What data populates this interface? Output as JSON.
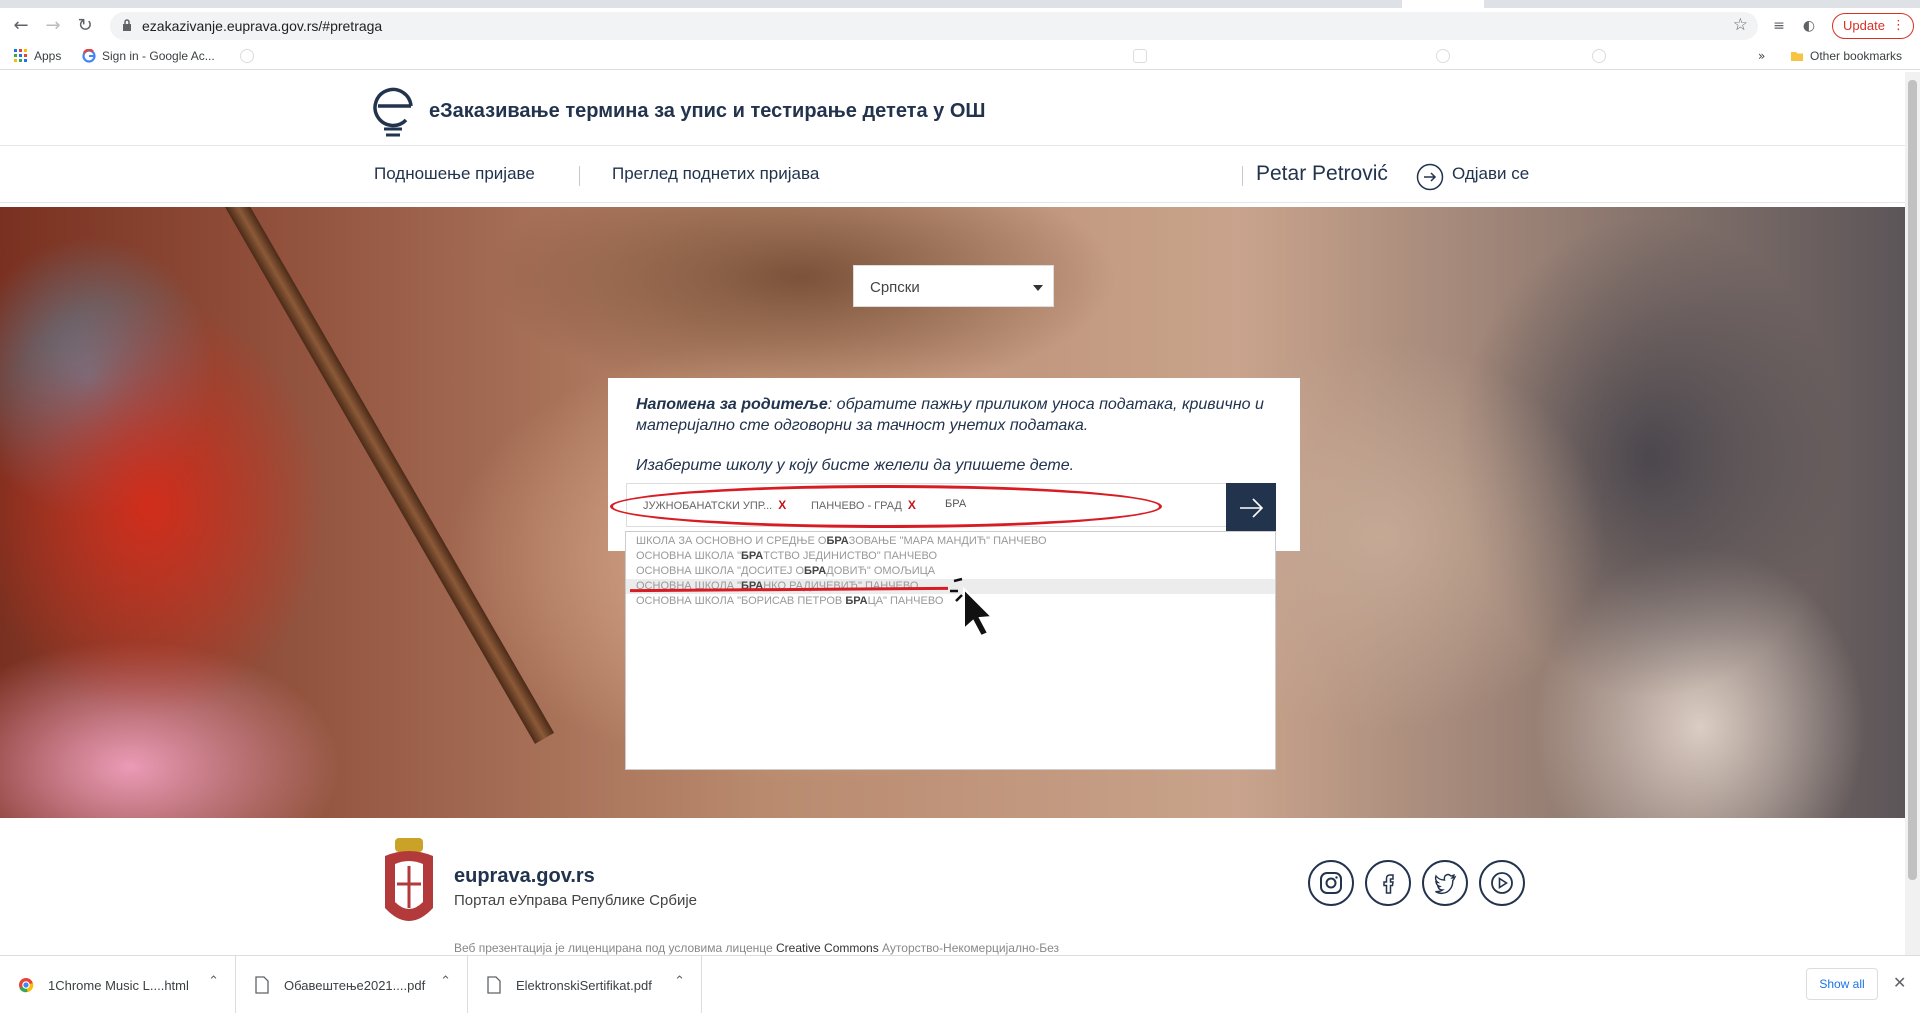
{
  "browser": {
    "url": "ezakazivanje.euprava.gov.rs/#pretraga",
    "update_label": "Update",
    "bookmarks": [
      {
        "label": "Apps",
        "icon": "apps-grid-icon"
      },
      {
        "label": "Sign in - Google Ac...",
        "icon": "google-icon"
      }
    ],
    "more_bookmarks": "»",
    "other_bookmarks": "Other bookmarks"
  },
  "site": {
    "title": "еЗаказивање термина за упис и тестирање детета у ОШ",
    "nav": [
      "Подношење пријаве",
      "Преглед поднетих пријава"
    ],
    "user": "Petar Petrović",
    "logout": "Одјави се"
  },
  "hero": {
    "language": "Српски",
    "notice_bold": "Напомена за родитеље",
    "notice_text": ": обратите пажњу приликом уноса података, кривично и материјално сте одговорни за тачност унетих података.",
    "choose_school": "Изаберите школу у коју бисте желели да упишете дете.",
    "filters": [
      {
        "label": "ЈУЖНОБАНАТСКИ УПР..."
      },
      {
        "label": "ПАНЧЕВО - ГРАД"
      }
    ],
    "remove_symbol": "X",
    "query": "БРА",
    "suggestions": [
      {
        "pre": "ШКОЛА ЗА ОСНОВНО И СРЕДЊЕ О",
        "match": "БРА",
        "post": "ЗОВАЊЕ \"МАРА МАНДИЋ\" ПАНЧЕВО",
        "highlighted": false
      },
      {
        "pre": "ОСНОВНА ШКОЛА \"",
        "match": "БРА",
        "post": "ТСТВО ЈЕДИНИСТВО\" ПАНЧЕВО",
        "highlighted": false
      },
      {
        "pre": "ОСНОВНА ШКОЛА \"ДОСИТЕЈ О",
        "match": "БРА",
        "post": "ДОВИЋ\" ОМОЉИЦА",
        "highlighted": false
      },
      {
        "pre": "ОСНОВНА ШКОЛА \"",
        "match": "БРА",
        "post": "НКО РАДИЧЕВИЋ\" ПАНЧЕВО",
        "highlighted": true
      },
      {
        "pre": "ОСНОВНА ШКОЛА \"БОРИСАВ ПЕТРОВ ",
        "match": "БРА",
        "post": "ЦА\" ПАНЧЕВО",
        "highlighted": false
      }
    ]
  },
  "footer": {
    "site": "euprava.gov.rs",
    "portal": "Портал еУправа Републике Србије",
    "license_pre": "Веб презентација је лиценцирана под условима лиценце ",
    "license_link": "Creative Commons",
    "license_post": " Ауторство-Некомерцијално-Без",
    "social": [
      "instagram-icon",
      "facebook-icon",
      "twitter-icon",
      "youtube-icon"
    ]
  },
  "downloads": {
    "items": [
      {
        "name": "1Chrome Music L....html"
      },
      {
        "name": "Обавештење2021....pdf"
      },
      {
        "name": "ElektronskiSertifikat.pdf"
      }
    ],
    "show_all": "Show all"
  },
  "colors": {
    "brand_navy": "#22334d",
    "annotation_red": "#d81c23",
    "remove_red": "#c4151c"
  }
}
